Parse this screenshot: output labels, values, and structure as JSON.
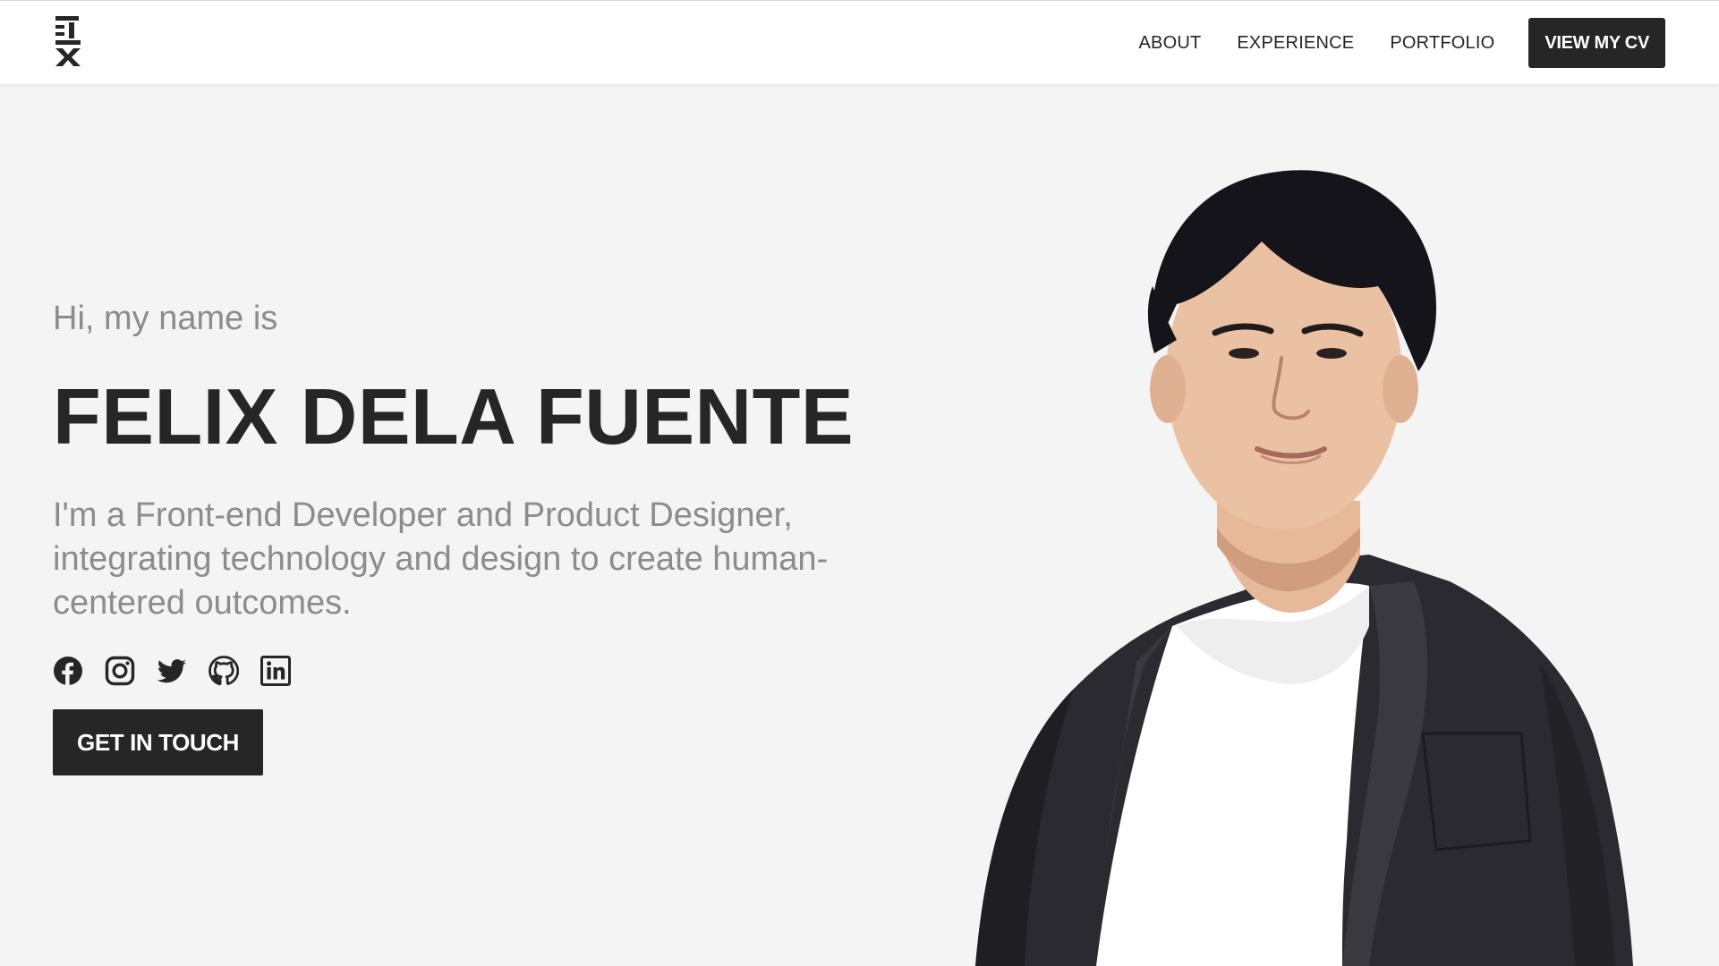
{
  "nav": {
    "links": [
      "ABOUT",
      "EXPERIENCE",
      "PORTFOLIO"
    ],
    "cv_button": "VIEW MY CV"
  },
  "hero": {
    "greeting": "Hi, my name is",
    "name": "FELIX DELA FUENTE",
    "tagline": "I'm a Front-end Developer and Product Designer, integrating technology and design to create human-centered outcomes.",
    "socials": [
      "facebook-icon",
      "instagram-icon",
      "twitter-icon",
      "github-icon",
      "linkedin-icon"
    ],
    "cta": "GET IN TOUCH"
  },
  "colors": {
    "background": "#f4f4f4",
    "accent": "#262626",
    "muted_text": "#8c8c8c"
  }
}
